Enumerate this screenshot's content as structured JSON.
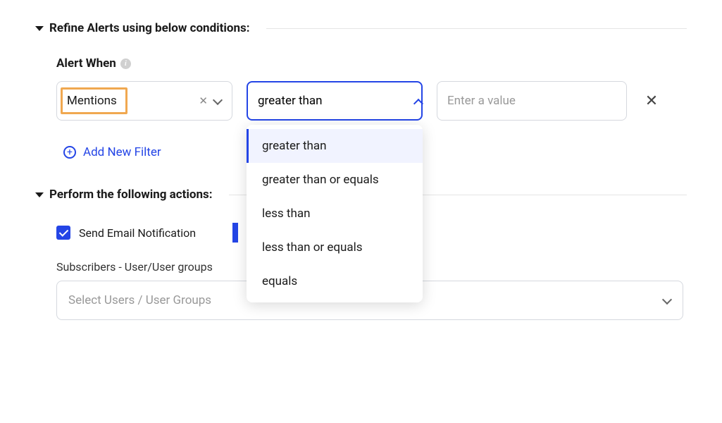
{
  "refine": {
    "title": "Refine Alerts using below conditions:",
    "alert_when_label": "Alert When",
    "metric_value": "Mentions",
    "operator_input": "greater than",
    "value_placeholder": "Enter a value",
    "dropdown_options": {
      "0": "greater than",
      "1": "greater than or equals",
      "2": "less than",
      "3": "less than or equals",
      "4": "equals"
    },
    "add_filter_label": "Add New Filter"
  },
  "actions": {
    "title": "Perform the following actions:",
    "email_checkbox_label": "Send Email Notification",
    "subscribers_label": "Subscribers - User/User groups",
    "subscribers_placeholder": "Select Users / User Groups"
  }
}
